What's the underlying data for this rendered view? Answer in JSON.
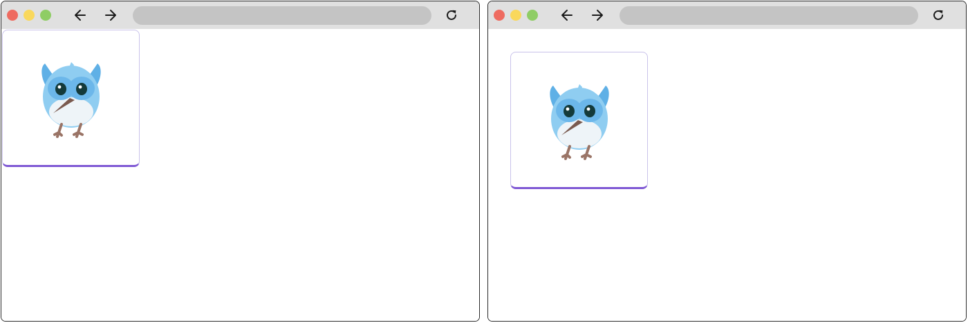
{
  "colors": {
    "close_dot": "#ee6b60",
    "minimize_dot": "#f9d85c",
    "zoom_dot": "#8fcd65",
    "card_accent": "#7e57d4",
    "card_border": "#c9c2ea",
    "bird_body": "#8fcdf1",
    "bird_wing": "#5fb0e6",
    "bird_face": "#6cb7ea",
    "bird_beak": "#7a5a4f",
    "bird_feet": "#9a7466"
  },
  "windows": [
    {
      "url": "",
      "icons": {
        "back": "arrow-left-icon",
        "forward": "arrow-right-icon",
        "reload": "reload-icon"
      },
      "card": {
        "image": "blue-bird-mascot"
      }
    },
    {
      "url": "",
      "icons": {
        "back": "arrow-left-icon",
        "forward": "arrow-right-icon",
        "reload": "reload-icon"
      },
      "card": {
        "image": "blue-bird-mascot"
      }
    }
  ]
}
